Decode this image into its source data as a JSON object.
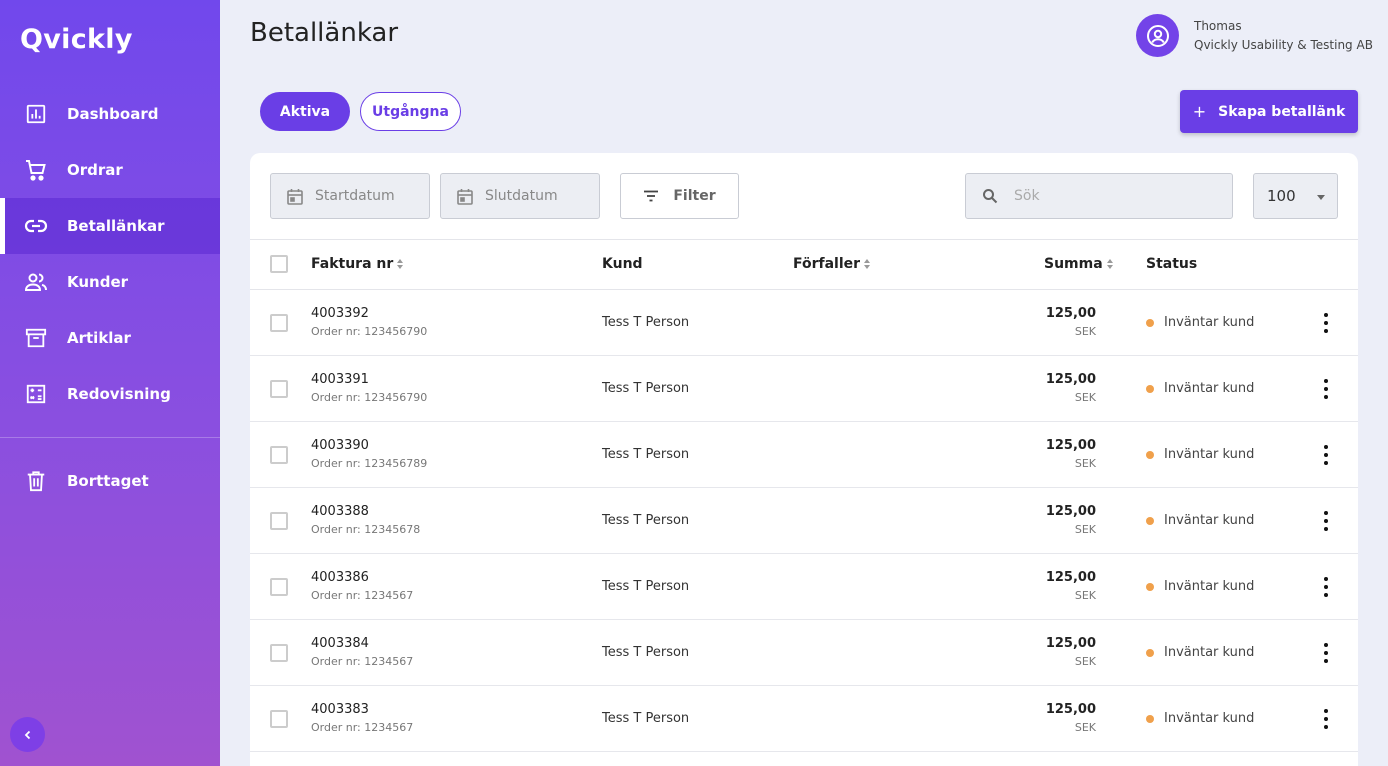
{
  "app": {
    "logo": "Qvickly"
  },
  "sidebar": {
    "items": [
      {
        "label": "Dashboard",
        "icon": "bar-chart-icon"
      },
      {
        "label": "Ordrar",
        "icon": "cart-icon"
      },
      {
        "label": "Betallänkar",
        "icon": "link-icon",
        "active": true
      },
      {
        "label": "Kunder",
        "icon": "people-icon"
      },
      {
        "label": "Artiklar",
        "icon": "archive-box-icon"
      },
      {
        "label": "Redovisning",
        "icon": "calculator-icon"
      }
    ],
    "bottom_items": [
      {
        "label": "Borttaget",
        "icon": "trash-icon"
      }
    ],
    "collapse_icon": "chevron-left-icon"
  },
  "header": {
    "title": "Betallänkar",
    "user_name": "Thomas",
    "company": "Qvickly Usability & Testing AB"
  },
  "tabs": [
    {
      "label": "Aktiva",
      "active": true
    },
    {
      "label": "Utgångna",
      "active": false
    }
  ],
  "create_button": {
    "icon": "+",
    "label": "Skapa betallänk"
  },
  "filters": {
    "start_date_placeholder": "Startdatum",
    "end_date_placeholder": "Slutdatum",
    "filter_label": "Filter",
    "search_placeholder": "Sök",
    "page_size": "100"
  },
  "table": {
    "columns": {
      "invoice": "Faktura nr",
      "customer": "Kund",
      "due": "Förfaller",
      "amount": "Summa",
      "status": "Status"
    },
    "rows": [
      {
        "invoice": "4003392",
        "order": "Order nr: 123456790",
        "customer": "Tess T Person",
        "amount": "125,00",
        "currency": "SEK",
        "status": "Inväntar kund"
      },
      {
        "invoice": "4003391",
        "order": "Order nr: 123456790",
        "customer": "Tess T Person",
        "amount": "125,00",
        "currency": "SEK",
        "status": "Inväntar kund"
      },
      {
        "invoice": "4003390",
        "order": "Order nr: 123456789",
        "customer": "Tess T Person",
        "amount": "125,00",
        "currency": "SEK",
        "status": "Inväntar kund"
      },
      {
        "invoice": "4003388",
        "order": "Order nr: 12345678",
        "customer": "Tess T Person",
        "amount": "125,00",
        "currency": "SEK",
        "status": "Inväntar kund"
      },
      {
        "invoice": "4003386",
        "order": "Order nr: 1234567",
        "customer": "Tess T Person",
        "amount": "125,00",
        "currency": "SEK",
        "status": "Inväntar kund"
      },
      {
        "invoice": "4003384",
        "order": "Order nr: 1234567",
        "customer": "Tess T Person",
        "amount": "125,00",
        "currency": "SEK",
        "status": "Inväntar kund"
      },
      {
        "invoice": "4003383",
        "order": "Order nr: 1234567",
        "customer": "Tess T Person",
        "amount": "125,00",
        "currency": "SEK",
        "status": "Inväntar kund"
      }
    ]
  },
  "colors": {
    "accent": "#6a3ee6",
    "status_pending": "#f0a04b"
  }
}
